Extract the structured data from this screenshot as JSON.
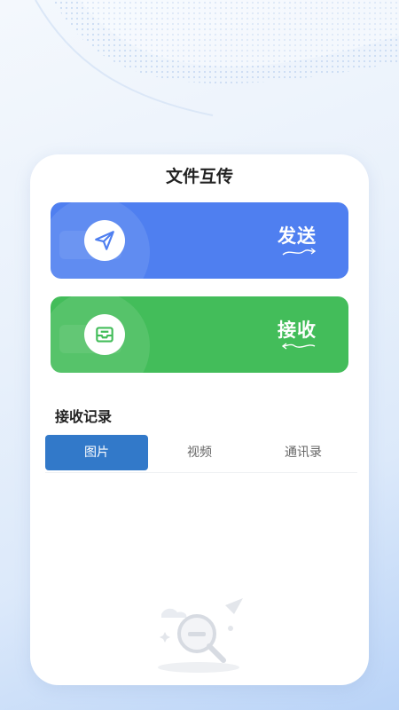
{
  "page": {
    "title": "文件互传"
  },
  "actions": [
    {
      "key": "send",
      "label": "发送",
      "icon": "paper-plane-icon",
      "color": "#4f7ff0"
    },
    {
      "key": "receive",
      "label": "接收",
      "icon": "inbox-tray-icon",
      "color": "#43bd5a"
    }
  ],
  "records": {
    "title": "接收记录",
    "tabs": [
      {
        "label": "图片",
        "active": true
      },
      {
        "label": "视频",
        "active": false
      },
      {
        "label": "通讯录",
        "active": false
      }
    ],
    "accent": "#3279c9"
  }
}
